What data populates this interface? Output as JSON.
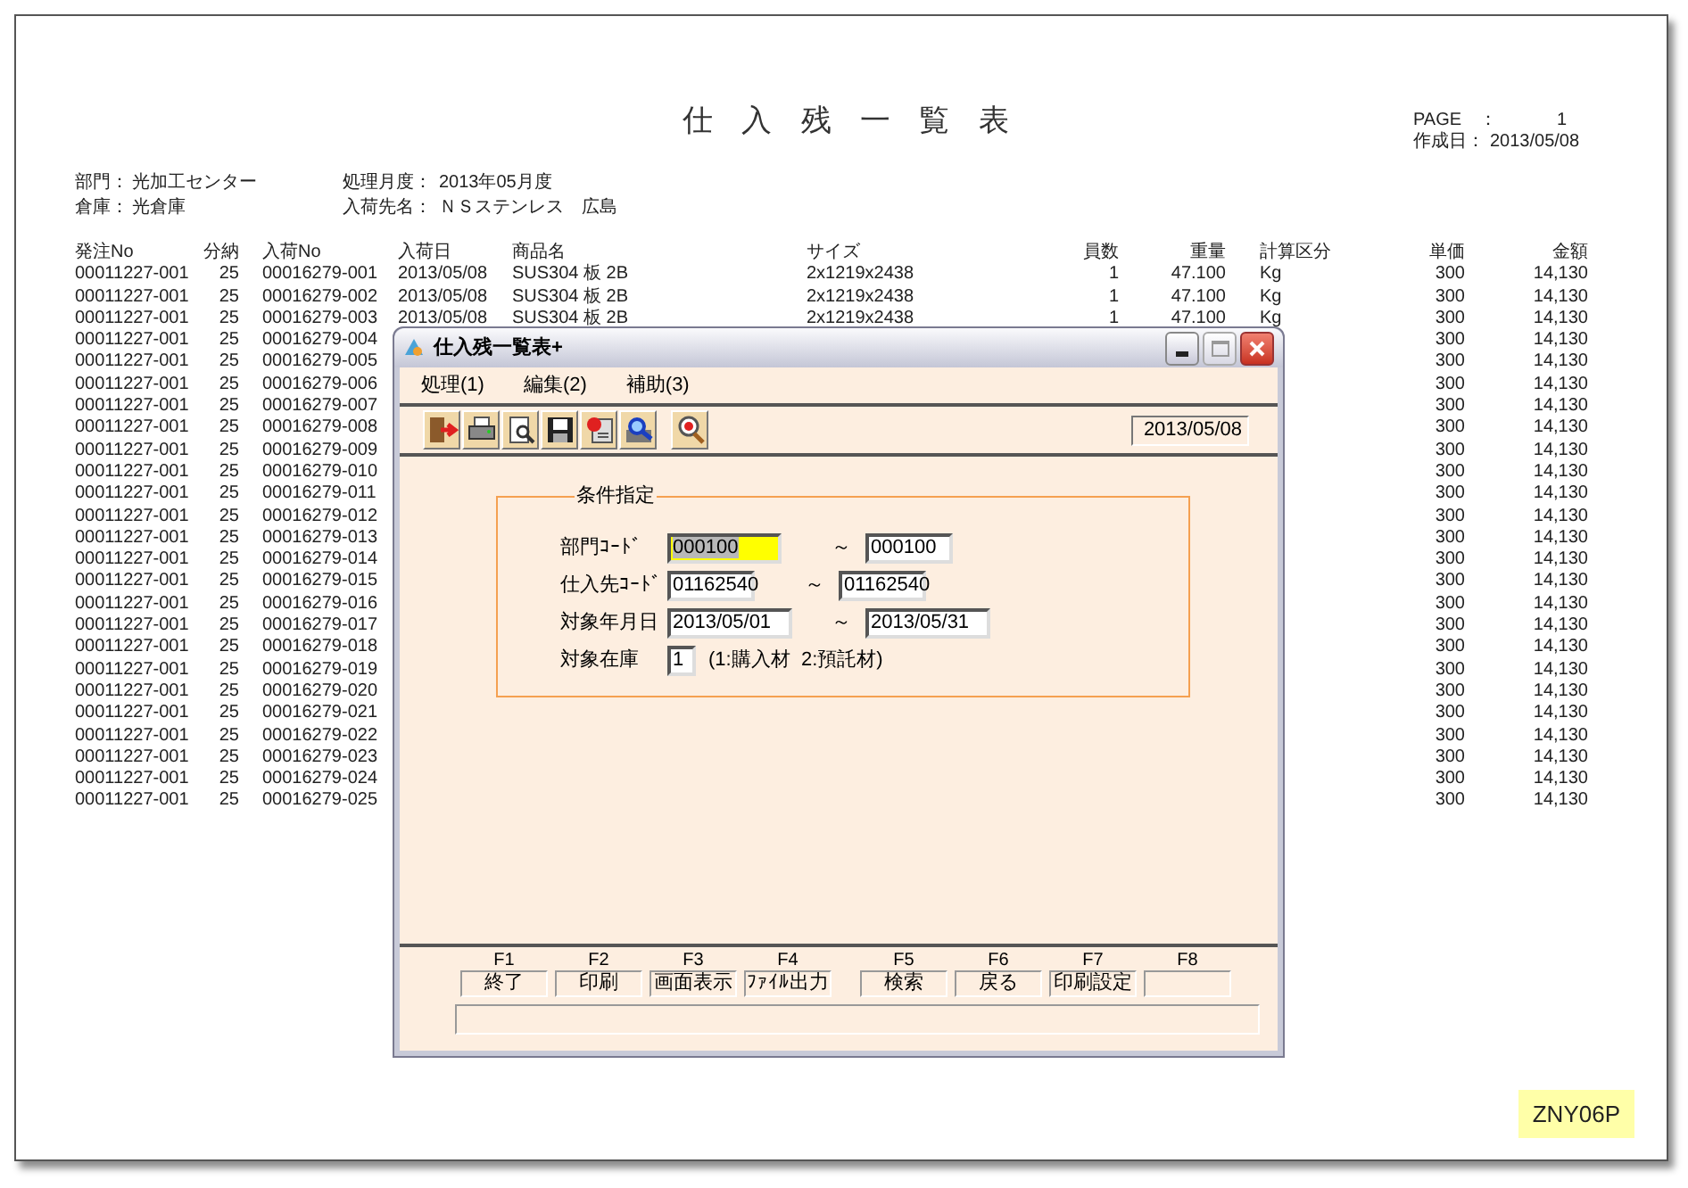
{
  "report": {
    "title": "仕入残一覧表",
    "page": {
      "label": "PAGE　：",
      "value": "1"
    },
    "created": {
      "label": "作成日：",
      "value": "2013/05/08"
    },
    "header_left": [
      {
        "label": "部門：",
        "value": "光加工センター"
      },
      {
        "label": "倉庫：",
        "value": "光倉庫"
      }
    ],
    "header_right": [
      {
        "label": "処理月度：",
        "value": "2013年05月度"
      },
      {
        "label": "入荷先名：",
        "value": "ＮＳステンレス　広島"
      }
    ],
    "columns": {
      "po": "発注No",
      "split": "分納",
      "receipt_no": "入荷No",
      "date": "入荷日",
      "product": "商品名",
      "size": "サイズ",
      "qty": "員数",
      "weight": "重量",
      "calc_unit": "計算区分",
      "unit_price": "単価",
      "amount": "金額"
    },
    "rows": [
      {
        "po": "00011227-001",
        "split": "25",
        "receipt_no": "00016279-001",
        "date": "2013/05/08",
        "product": "SUS304 板 2B",
        "size": "2x1219x2438",
        "qty": "1",
        "weight": "47.100",
        "calc_unit": "Kg",
        "unit_price": "300",
        "amount": "14,130"
      },
      {
        "po": "00011227-001",
        "split": "25",
        "receipt_no": "00016279-002",
        "date": "2013/05/08",
        "product": "SUS304 板 2B",
        "size": "2x1219x2438",
        "qty": "1",
        "weight": "47.100",
        "calc_unit": "Kg",
        "unit_price": "300",
        "amount": "14,130"
      },
      {
        "po": "00011227-001",
        "split": "25",
        "receipt_no": "00016279-003",
        "date": "2013/05/08",
        "product": "SUS304 板 2B",
        "size": "2x1219x2438",
        "qty": "1",
        "weight": "47.100",
        "calc_unit": "Kg",
        "unit_price": "300",
        "amount": "14,130"
      },
      {
        "po": "00011227-001",
        "split": "25",
        "receipt_no": "00016279-004",
        "unit_price": "300",
        "amount": "14,130"
      },
      {
        "po": "00011227-001",
        "split": "25",
        "receipt_no": "00016279-005",
        "unit_price": "300",
        "amount": "14,130"
      },
      {
        "po": "00011227-001",
        "split": "25",
        "receipt_no": "00016279-006",
        "unit_price": "300",
        "amount": "14,130"
      },
      {
        "po": "00011227-001",
        "split": "25",
        "receipt_no": "00016279-007",
        "unit_price": "300",
        "amount": "14,130"
      },
      {
        "po": "00011227-001",
        "split": "25",
        "receipt_no": "00016279-008",
        "unit_price": "300",
        "amount": "14,130"
      },
      {
        "po": "00011227-001",
        "split": "25",
        "receipt_no": "00016279-009",
        "unit_price": "300",
        "amount": "14,130"
      },
      {
        "po": "00011227-001",
        "split": "25",
        "receipt_no": "00016279-010",
        "unit_price": "300",
        "amount": "14,130"
      },
      {
        "po": "00011227-001",
        "split": "25",
        "receipt_no": "00016279-011",
        "unit_price": "300",
        "amount": "14,130"
      },
      {
        "po": "00011227-001",
        "split": "25",
        "receipt_no": "00016279-012",
        "unit_price": "300",
        "amount": "14,130"
      },
      {
        "po": "00011227-001",
        "split": "25",
        "receipt_no": "00016279-013",
        "unit_price": "300",
        "amount": "14,130"
      },
      {
        "po": "00011227-001",
        "split": "25",
        "receipt_no": "00016279-014",
        "unit_price": "300",
        "amount": "14,130"
      },
      {
        "po": "00011227-001",
        "split": "25",
        "receipt_no": "00016279-015",
        "unit_price": "300",
        "amount": "14,130"
      },
      {
        "po": "00011227-001",
        "split": "25",
        "receipt_no": "00016279-016",
        "unit_price": "300",
        "amount": "14,130"
      },
      {
        "po": "00011227-001",
        "split": "25",
        "receipt_no": "00016279-017",
        "unit_price": "300",
        "amount": "14,130"
      },
      {
        "po": "00011227-001",
        "split": "25",
        "receipt_no": "00016279-018",
        "unit_price": "300",
        "amount": "14,130"
      },
      {
        "po": "00011227-001",
        "split": "25",
        "receipt_no": "00016279-019",
        "unit_price": "300",
        "amount": "14,130"
      },
      {
        "po": "00011227-001",
        "split": "25",
        "receipt_no": "00016279-020",
        "unit_price": "300",
        "amount": "14,130"
      },
      {
        "po": "00011227-001",
        "split": "25",
        "receipt_no": "00016279-021",
        "unit_price": "300",
        "amount": "14,130"
      },
      {
        "po": "00011227-001",
        "split": "25",
        "receipt_no": "00016279-022",
        "unit_price": "300",
        "amount": "14,130"
      },
      {
        "po": "00011227-001",
        "split": "25",
        "receipt_no": "00016279-023",
        "unit_price": "300",
        "amount": "14,130"
      },
      {
        "po": "00011227-001",
        "split": "25",
        "receipt_no": "00016279-024",
        "unit_price": "300",
        "amount": "14,130"
      },
      {
        "po": "00011227-001",
        "split": "25",
        "receipt_no": "00016279-025",
        "unit_price": "300",
        "amount": "14,130"
      }
    ]
  },
  "dialog": {
    "title": "仕入残一覧表+",
    "menu": [
      "処理(1)",
      "編集(2)",
      "補助(3)"
    ],
    "toolbar_date": "2013/05/08",
    "conditions": {
      "title": "条件指定",
      "rows": [
        {
          "kind": "range",
          "label": "部門ｺｰﾄﾞ",
          "from": {
            "value": "000100",
            "focused": true
          },
          "separator": "～",
          "to": {
            "value": "000100",
            "focused": false
          }
        },
        {
          "kind": "range",
          "label": "仕入先ｺｰﾄﾞ",
          "from": {
            "value": "01162540",
            "focused": false
          },
          "separator": "～",
          "to": {
            "value": "01162540",
            "focused": false
          }
        },
        {
          "kind": "range",
          "label": "対象年月日",
          "from": {
            "value": "2013/05/01",
            "focused": false
          },
          "separator": "～",
          "to": {
            "value": "2013/05/31",
            "focused": false
          }
        },
        {
          "kind": "single",
          "label": "対象在庫",
          "from": {
            "value": "1",
            "focused": false
          },
          "note": "(1:購入材  2:預託材)"
        }
      ]
    },
    "function_keys": [
      {
        "key": "F1",
        "label": "終了"
      },
      {
        "key": "F2",
        "label": "印刷"
      },
      {
        "key": "F3",
        "label": "画面表示"
      },
      {
        "key": "F4",
        "label": "ﾌｧｲﾙ出力"
      },
      {
        "key": "F5",
        "label": "検索"
      },
      {
        "key": "F6",
        "label": "戻る"
      },
      {
        "key": "F7",
        "label": "印刷設定"
      },
      {
        "key": "F8"
      }
    ]
  },
  "page_label": "ZNY06P"
}
